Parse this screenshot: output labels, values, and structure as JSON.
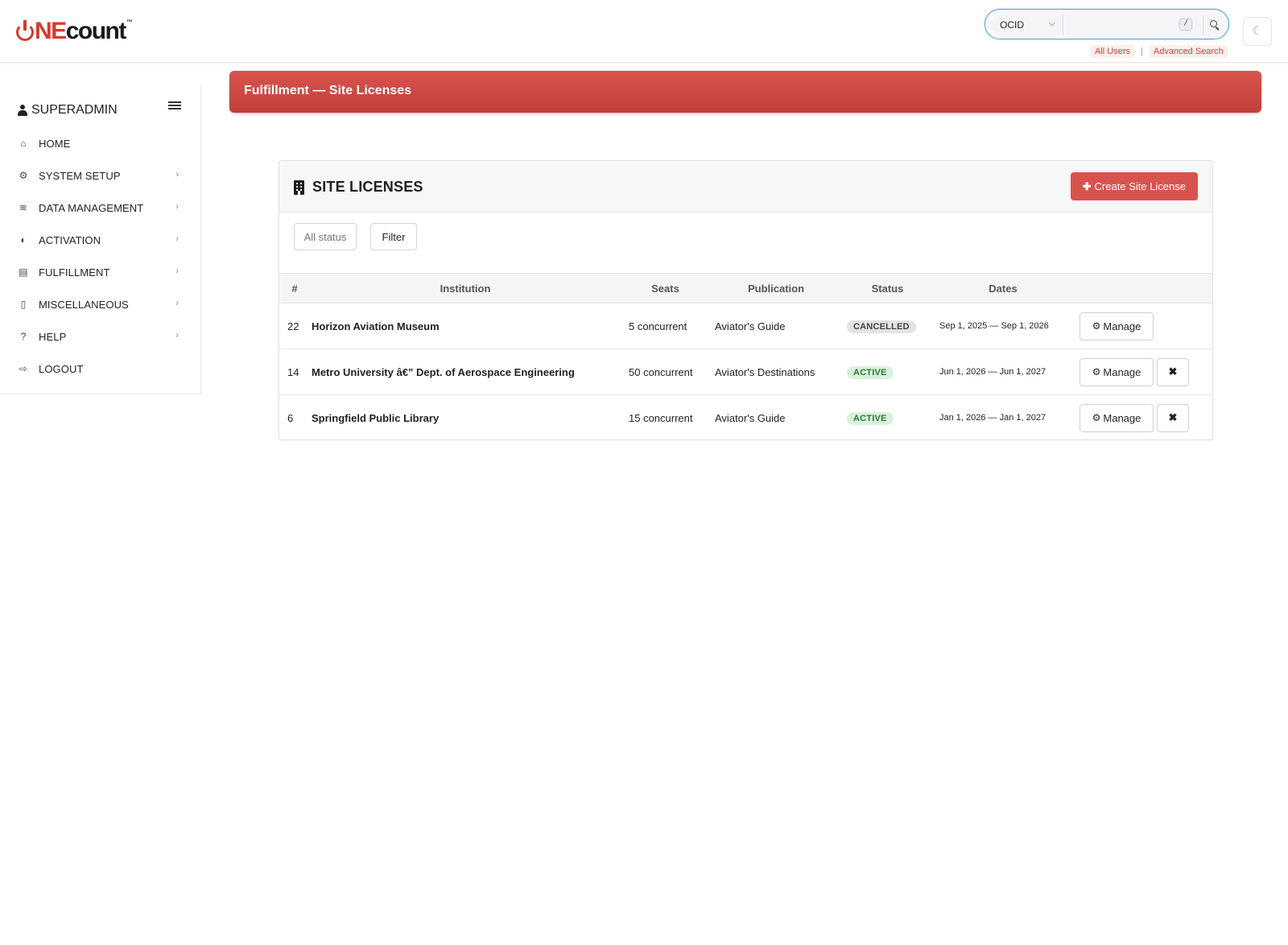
{
  "brand": {
    "logo_ne": "NE",
    "logo_count": "count",
    "logo_tm": "™",
    "accent": "#d9534e",
    "logo_red": "#d63a31"
  },
  "search": {
    "select_value": "OCID",
    "placeholder": "",
    "shortcut": "/",
    "links": [
      "All Users",
      "Advanced Search"
    ],
    "separator": "|"
  },
  "theme_toggle": {
    "icon": "moon-icon",
    "glyph": "☾"
  },
  "sidebar": {
    "user_label": "SUPERADMIN",
    "items": [
      {
        "label": "HOME",
        "icon": "home-icon",
        "glyph": "⌂",
        "has_submenu": false
      },
      {
        "label": "SYSTEM SETUP",
        "icon": "gear-icon",
        "glyph": "⚙",
        "has_submenu": true
      },
      {
        "label": "DATA MANAGEMENT",
        "icon": "database-icon",
        "glyph": "≋",
        "has_submenu": true
      },
      {
        "label": "ACTIVATION",
        "icon": "toggle-icon",
        "glyph": "◐",
        "has_submenu": true
      },
      {
        "label": "FULFILLMENT",
        "icon": "newspaper-icon",
        "glyph": "▤",
        "has_submenu": true
      },
      {
        "label": "MISCELLANEOUS",
        "icon": "file-icon",
        "glyph": "▯",
        "has_submenu": true
      },
      {
        "label": "HELP",
        "icon": "question-icon",
        "glyph": "?",
        "has_submenu": true
      },
      {
        "label": "LOGOUT",
        "icon": "sign-out-icon",
        "glyph": "⇨",
        "has_submenu": false
      }
    ],
    "arrow": "›"
  },
  "banner": {
    "title": "Fulfillment — Site Licenses"
  },
  "card": {
    "title": "SITE LICENSES",
    "create_label": "Create Site License",
    "status_filter": "All status",
    "filter_label": "Filter"
  },
  "table": {
    "headers": [
      "#",
      "Institution",
      "Seats",
      "Publication",
      "Status",
      "Dates"
    ],
    "rows": [
      {
        "id": "22",
        "institution": "Horizon Aviation Museum",
        "seats": "5 concurrent",
        "publication": "Aviator's Guide",
        "status": "CANCELLED",
        "dates": "Sep 1, 2025 — Sep 1, 2026",
        "can_delete": false
      },
      {
        "id": "14",
        "institution": "Metro University â€” Dept. of Aerospace Engineering",
        "seats": "50 concurrent",
        "publication": "Aviator's Destinations",
        "status": "ACTIVE",
        "dates": "Jun 1, 2026 — Jun 1, 2027",
        "can_delete": true
      },
      {
        "id": "6",
        "institution": "Springfield Public Library",
        "seats": "15 concurrent",
        "publication": "Aviator's Guide",
        "status": "ACTIVE",
        "dates": "Jan 1, 2026 — Jan 1, 2027",
        "can_delete": true
      }
    ],
    "manage_label": "Manage"
  }
}
